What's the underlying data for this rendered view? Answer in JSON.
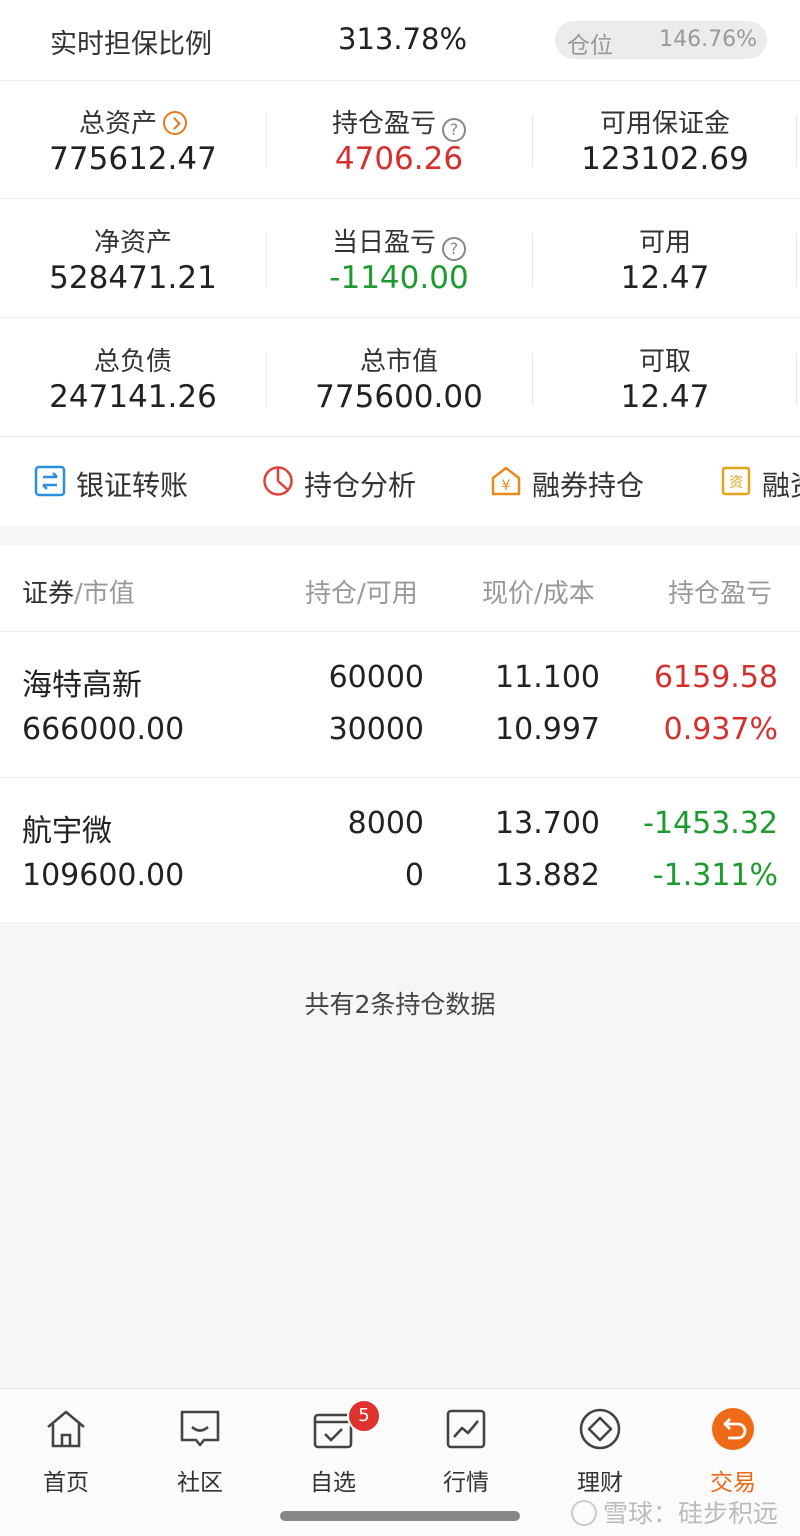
{
  "header": {
    "ratio_label": "实时担保比例",
    "ratio_value": "313.78%",
    "position_label": "仓位",
    "position_value": "146.76%"
  },
  "summary": [
    [
      {
        "label": "总资产",
        "value": "775612.47",
        "icon": "chevron-right-circle-icon"
      },
      {
        "label": "持仓盈亏",
        "value": "4706.26",
        "icon": "help-icon",
        "tone": "up"
      },
      {
        "label": "可用保证金",
        "value": "123102.69"
      }
    ],
    [
      {
        "label": "净资产",
        "value": "528471.21"
      },
      {
        "label": "当日盈亏",
        "value": "-1140.00",
        "icon": "help-icon",
        "tone": "down"
      },
      {
        "label": "可用",
        "value": "12.47"
      }
    ],
    [
      {
        "label": "总负债",
        "value": "247141.26"
      },
      {
        "label": "总市值",
        "value": "775600.00"
      },
      {
        "label": "可取",
        "value": "12.47"
      }
    ]
  ],
  "actions": [
    {
      "label": "银证转账",
      "icon": "transfer-icon"
    },
    {
      "label": "持仓分析",
      "icon": "pie-chart-icon"
    },
    {
      "label": "融券持仓",
      "icon": "yen-house-icon"
    },
    {
      "label": "融资",
      "icon": "receipt-icon"
    }
  ],
  "table": {
    "headers": {
      "col1_main": "证券",
      "col1_sub": "/市值",
      "col2": "持仓/可用",
      "col3": "现价/成本",
      "col4": "持仓盈亏"
    },
    "rows": [
      {
        "name": "海特高新",
        "market_value": "666000.00",
        "position": "60000",
        "available": "30000",
        "price": "11.100",
        "cost": "10.997",
        "pnl": "6159.58",
        "pnl_pct": "0.937%",
        "tone": "up"
      },
      {
        "name": "航宇微",
        "market_value": "109600.00",
        "position": "8000",
        "available": "0",
        "price": "13.700",
        "cost": "13.882",
        "pnl": "-1453.32",
        "pnl_pct": "-1.311%",
        "tone": "down"
      }
    ],
    "footer": "共有2条持仓数据"
  },
  "tabbar": {
    "tabs": [
      {
        "label": "首页",
        "icon": "home-icon"
      },
      {
        "label": "社区",
        "icon": "chat-icon"
      },
      {
        "label": "自选",
        "icon": "watchlist-icon",
        "badge": "5"
      },
      {
        "label": "行情",
        "icon": "market-chart-icon"
      },
      {
        "label": "理财",
        "icon": "diamond-icon"
      },
      {
        "label": "交易",
        "icon": "trade-icon",
        "active": true
      }
    ]
  },
  "watermark": "雪球：硅步积远",
  "colors": {
    "accent": "#ee6a16",
    "up": "#d6302e",
    "down": "#1e9b2e"
  }
}
